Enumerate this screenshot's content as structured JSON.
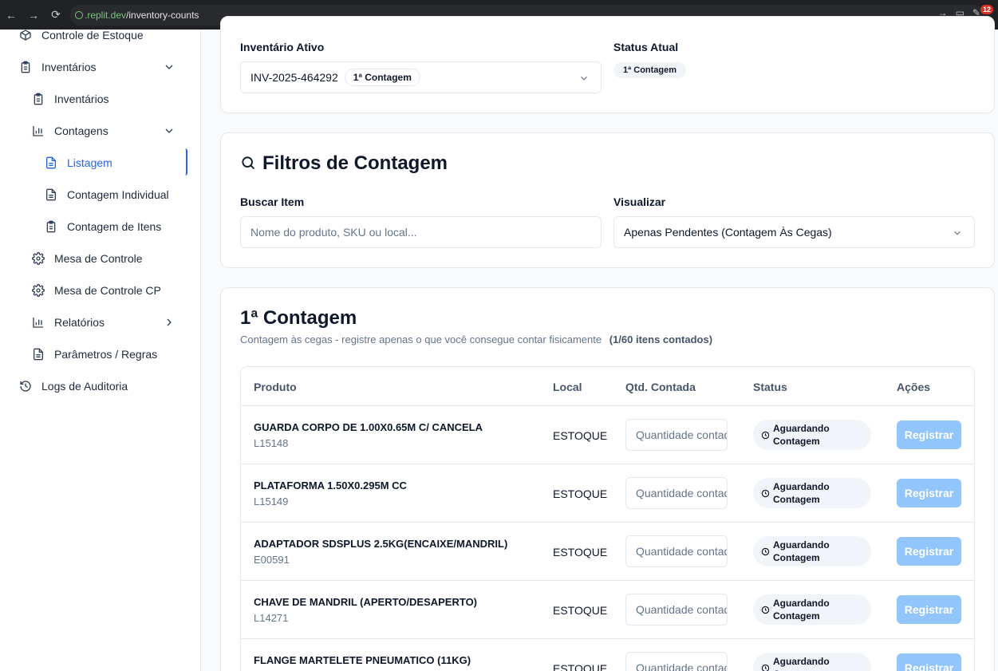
{
  "browser": {
    "url_domain": ".replit.dev",
    "url_path": "/inventory-counts",
    "badge": "12"
  },
  "sidebar": {
    "items": [
      {
        "label": "Controle de Estoque",
        "icon": "box-icon"
      },
      {
        "label": "Inventários",
        "icon": "clipboard-icon"
      },
      {
        "label": "Inventários",
        "icon": "clipboard-icon"
      },
      {
        "label": "Contagens",
        "icon": "bar-chart-icon"
      },
      {
        "label": "Listagem",
        "icon": "file-text-icon"
      },
      {
        "label": "Contagem Individual",
        "icon": "file-text-icon"
      },
      {
        "label": "Contagem de Itens",
        "icon": "clipboard-icon"
      },
      {
        "label": "Mesa de Controle",
        "icon": "gear-icon"
      },
      {
        "label": "Mesa de Controle CP",
        "icon": "gear-icon"
      },
      {
        "label": "Relatórios",
        "icon": "bar-chart-icon"
      },
      {
        "label": "Parâmetros / Regras",
        "icon": "file-text-icon"
      },
      {
        "label": "Logs de Auditoria",
        "icon": "history-icon"
      }
    ]
  },
  "inventory": {
    "active_label": "Inventário Ativo",
    "active_value": "INV-2025-464292",
    "active_badge": "1ª Contagem",
    "status_label": "Status Atual",
    "status_value": "1ª Contagem"
  },
  "filters": {
    "title": "Filtros de Contagem",
    "search_label": "Buscar Item",
    "search_placeholder": "Nome do produto, SKU ou local...",
    "view_label": "Visualizar",
    "view_value": "Apenas Pendentes (Contagem Às Cegas)"
  },
  "counting": {
    "title": "1ª Contagem",
    "subtitle": "Contagem às cegas - registre apenas o que você consegue contar fisicamente",
    "progress": "(1/60 itens contados)",
    "columns": [
      "Produto",
      "Local",
      "Qtd. Contada",
      "Status",
      "Ações"
    ],
    "qty_placeholder": "Quantidade contada",
    "status_line1": "Aguardando",
    "status_line2": "Contagem",
    "register_label": "Registrar",
    "rows": [
      {
        "name": "GUARDA CORPO DE 1.00X0.65M C/ CANCELA",
        "sku": "L15148",
        "local": "ESTOQUE"
      },
      {
        "name": "PLATAFORMA 1.50X0.295M CC",
        "sku": "L15149",
        "local": "ESTOQUE"
      },
      {
        "name": "ADAPTADOR SDSPLUS 2.5KG(ENCAIXE/MANDRIL)",
        "sku": "E00591",
        "local": "ESTOQUE"
      },
      {
        "name": "CHAVE DE MANDRIL (APERTO/DESAPERTO)",
        "sku": "L14271",
        "local": "ESTOQUE"
      },
      {
        "name": "FLANGE MARTELETE PNEUMATICO (11KG)",
        "sku": "",
        "local": "ESTOQUE"
      }
    ]
  }
}
